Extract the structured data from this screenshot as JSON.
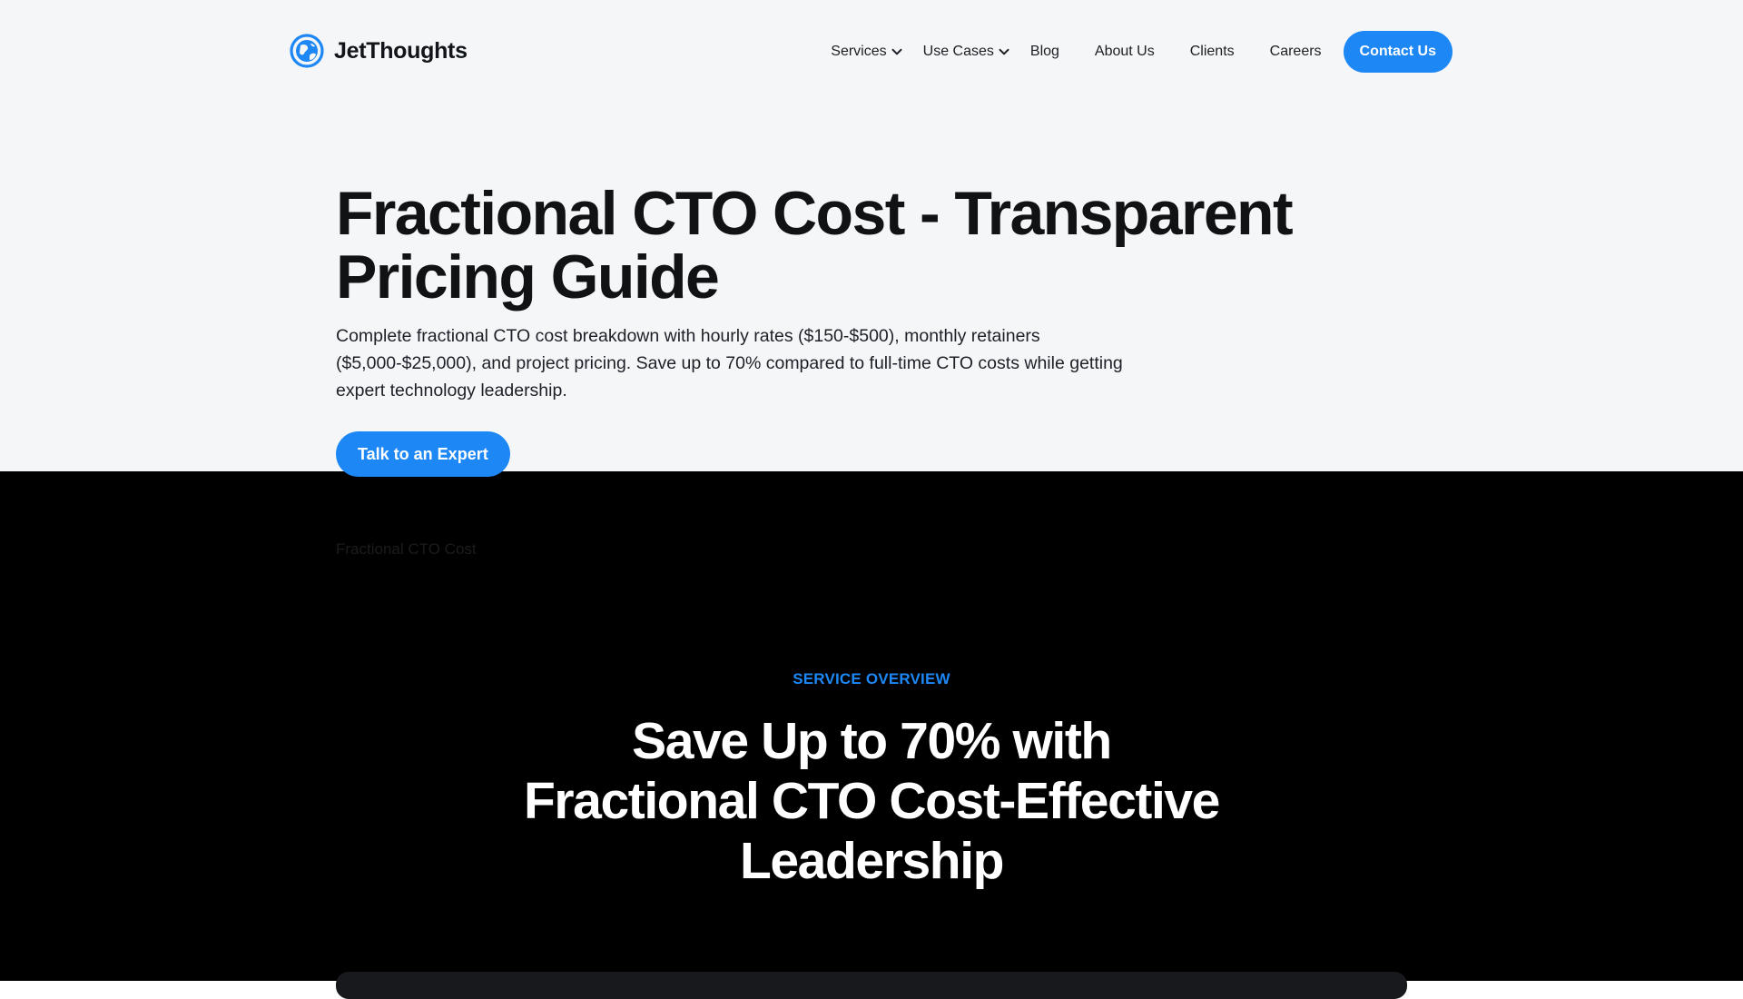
{
  "header": {
    "logo_text": "JetThoughts",
    "logo_icon": "globe-logo-icon",
    "nav": {
      "services": "Services",
      "use_cases": "Use Cases",
      "blog": "Blog",
      "about": "About Us",
      "clients": "Clients",
      "careers": "Careers"
    },
    "contact_label": "Contact Us"
  },
  "hero": {
    "title": "Fractional CTO Cost - Transparent Pricing Guide",
    "description": "Complete fractional CTO cost breakdown with hourly rates ($150-$500), monthly retainers ($5,000-$25,000), and project pricing. Save up to 70% compared to full-time CTO costs while getting expert technology leadership.",
    "cta_label": "Talk to an Expert"
  },
  "breadcrumb": "Fractional CTO Cost",
  "overview": {
    "eyebrow": "SERVICE OVERVIEW",
    "title": "Save Up to 70% with Fractional CTO Cost-Effective Leadership"
  },
  "colors": {
    "accent": "#1d87f5",
    "hero_bg": "#f4f6f8",
    "dark_bg": "#000000",
    "text_dark": "#101214"
  }
}
